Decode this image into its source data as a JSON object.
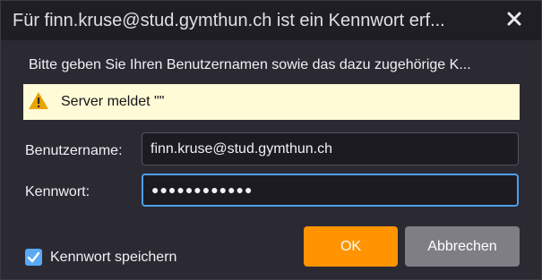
{
  "dialog": {
    "title": "Für finn.kruse@stud.gymthun.ch ist ein Kennwort erf...",
    "close_icon": "close-icon",
    "message": "Bitte geben Sie Ihren Benutzernamen sowie das dazu zugehörige K..."
  },
  "notice": {
    "icon": "warning-icon",
    "icon_color": "#e8a400",
    "background": "#fffbd6",
    "text": "Server meldet \"\""
  },
  "form": {
    "username_label": "Benutzername:",
    "username_value": "finn.kruse@stud.gymthun.ch",
    "password_label": "Kennwort:",
    "password_value": "●●●●●●●●●●●●",
    "remember_label": "Kennwort speichern",
    "remember_checked": true
  },
  "buttons": {
    "ok_label": "OK",
    "cancel_label": "Abbrechen"
  },
  "colors": {
    "accent": "#5aa9f5",
    "ok_button": "#ff9400",
    "cancel_button": "#7f7e85"
  }
}
